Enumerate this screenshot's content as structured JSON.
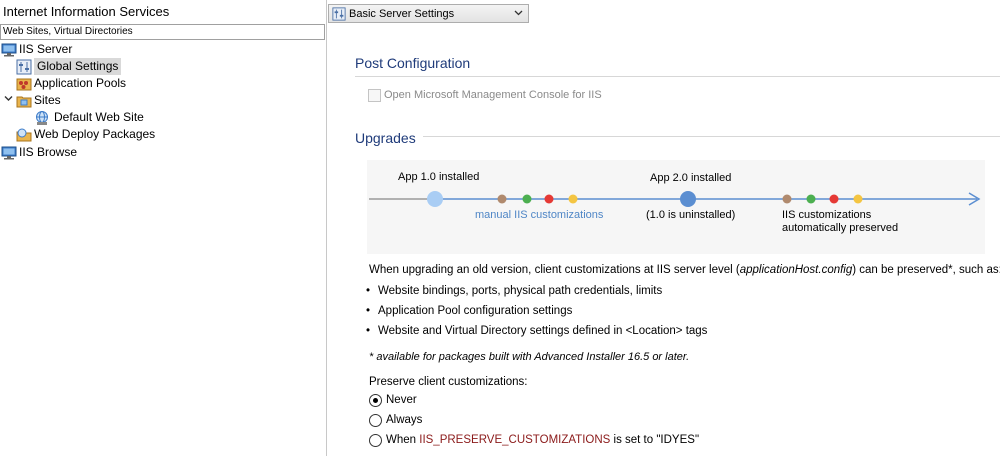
{
  "left_pane": {
    "title": "Internet Information Services",
    "filter_text": "Web Sites, Virtual Directories",
    "tree": [
      {
        "label": "IIS Server",
        "icon": "server-icon"
      },
      {
        "label": "Global Settings",
        "icon": "settings-icon",
        "selected": true
      },
      {
        "label": "Application Pools",
        "icon": "app-pools-icon"
      },
      {
        "label": "Sites",
        "icon": "sites-folder-icon",
        "expanded": true
      },
      {
        "label": "Default Web Site",
        "icon": "web-site-icon"
      },
      {
        "label": "Web Deploy Packages",
        "icon": "deploy-packages-icon"
      },
      {
        "label": "IIS Browse",
        "icon": "browse-icon"
      }
    ]
  },
  "right_pane": {
    "mode_select": {
      "value": "Basic Server Settings",
      "icon": "settings-icon"
    },
    "post_configuration": {
      "title": "Post Configuration",
      "checkbox_label": "Open Microsoft Management Console for IIS",
      "checked": false,
      "enabled": false
    },
    "upgrades": {
      "title": "Upgrades",
      "diagram": {
        "app1_label": "App 1.0 installed",
        "app2_label": "App 2.0 installed",
        "manual_label": "manual IIS customizations",
        "uninstalled_label": "(1.0 is uninstalled)",
        "preserved_line1": "IIS customizations",
        "preserved_line2": "automatically preserved",
        "colors": {
          "app1": "#a9cdf4",
          "app2": "#5b8ed1",
          "brown": "#b08a6e",
          "green": "#4caf50",
          "red": "#e53935",
          "yellow": "#f4c542",
          "arrow": "#5b8ed1",
          "line_left": "#9a9a9a",
          "manual_text": "#4f86c6"
        }
      },
      "description_prefix": "When upgrading an old version, client customizations at IIS server level (",
      "description_italic": "applicationHost.config",
      "description_suffix": ") can be preserved*, such as:",
      "bullets": [
        "Website bindings, ports, physical path credentials, limits",
        "Application Pool configuration settings",
        "Website and Virtual Directory settings defined in <Location> tags"
      ],
      "footnote": "* available for packages built with Advanced Installer 16.5 or later.",
      "preserve_label": "Preserve client customizations:",
      "options": [
        {
          "label": "Never",
          "checked": true
        },
        {
          "label": "Always",
          "checked": false
        },
        {
          "label_prefix": "When ",
          "label_var": "IIS_PRESERVE_CUSTOMIZATIONS",
          "label_suffix": " is set to \"IDYES\"",
          "checked": false
        }
      ]
    }
  }
}
